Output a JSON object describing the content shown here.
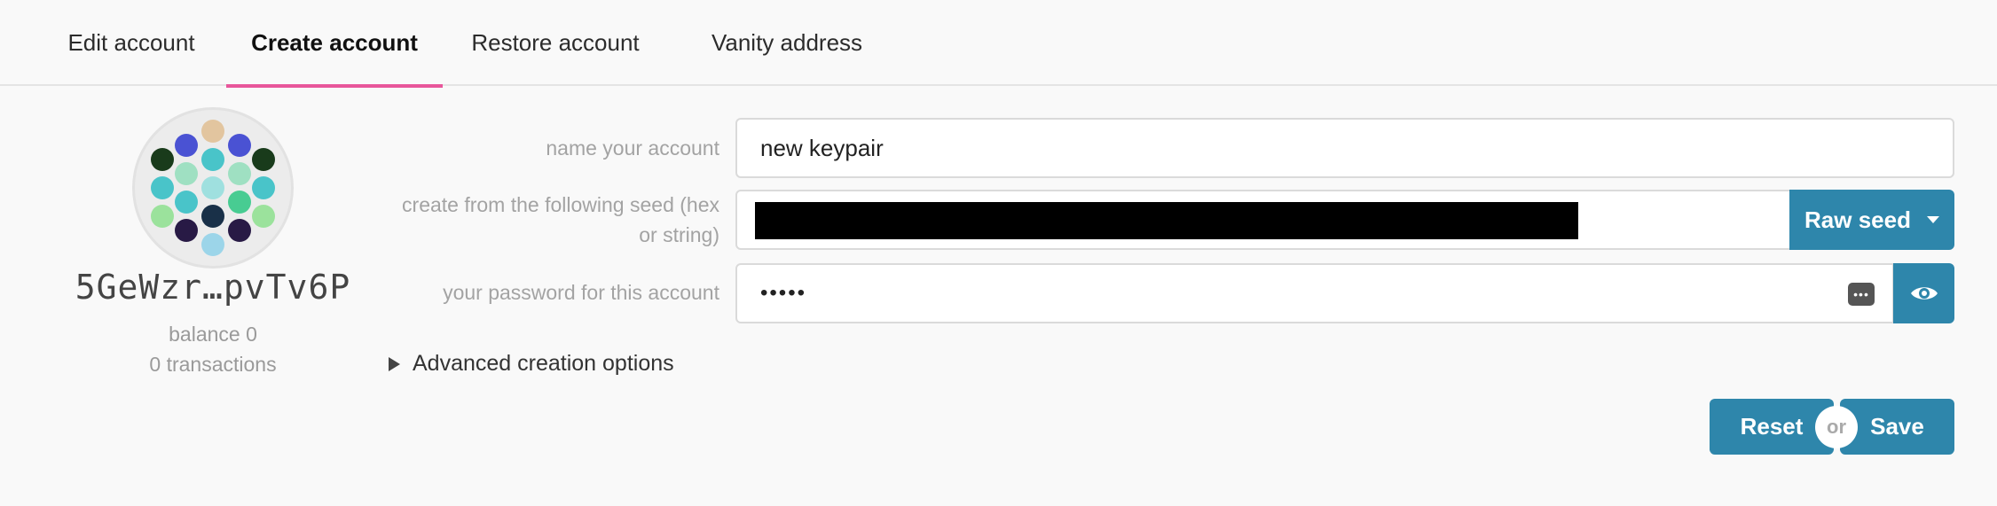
{
  "tabs": [
    {
      "label": "Edit account"
    },
    {
      "label": "Create account"
    },
    {
      "label": "Restore account"
    },
    {
      "label": "Vanity address"
    }
  ],
  "active_tab": "Create account",
  "accent_color": "#e8569b",
  "primary_color": "#2e86ab",
  "account": {
    "address": "5GeWzr…pvTv6P",
    "balance": "balance 0",
    "transactions": "0 transactions"
  },
  "identicon_colors": [
    "#e2c59f",
    "#4a52d3",
    "#4a52d3",
    "#193b1b",
    "#9fe0c2",
    "#49c4c9",
    "#9fe0c2",
    "#193b1b",
    "#49c4c9",
    "#9fe0df",
    "#49c4c9",
    "#49c4c9",
    "#48cc92",
    "#193048",
    "#48cc92",
    "#9be29c",
    "#281a45",
    "#281a45",
    "#9be29c",
    "#9cd5e9"
  ],
  "form": {
    "name_label": "name your account",
    "name_value": "new keypair",
    "seed_label_line1": "create from the following seed (hex",
    "seed_label_line2": "or string)",
    "seed_type_label": "Raw seed",
    "password_label": "your password for this account",
    "password_value": "•••••",
    "password_manager_glyph": "•••",
    "advanced_label": "Advanced creation options"
  },
  "actions": {
    "reset_label": "Reset",
    "or_label": "or",
    "save_label": "Save"
  }
}
